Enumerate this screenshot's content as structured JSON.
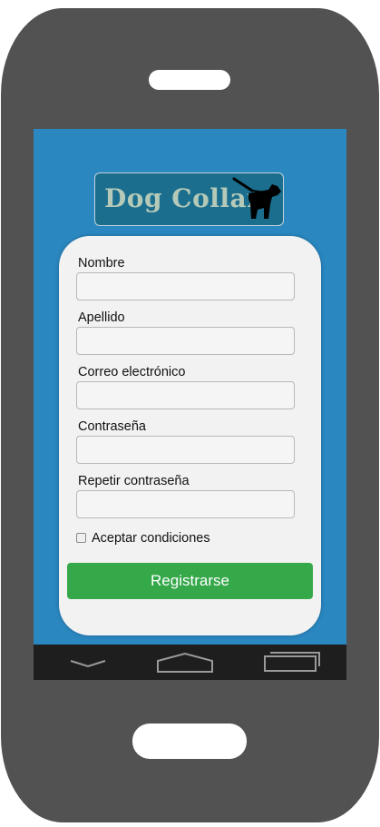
{
  "app": {
    "logo_text": "Dog Collar",
    "logo_icon": "dog-walker-icon"
  },
  "form": {
    "fields": [
      {
        "label": "Nombre",
        "value": "",
        "placeholder": ""
      },
      {
        "label": "Apellido",
        "value": "",
        "placeholder": ""
      },
      {
        "label": "Correo electrónico",
        "value": "",
        "placeholder": ""
      },
      {
        "label": "Contraseña",
        "value": "",
        "placeholder": ""
      },
      {
        "label": "Repetir contraseña",
        "value": "",
        "placeholder": ""
      }
    ],
    "terms_label": "Aceptar condiciones",
    "terms_checked": false,
    "submit_label": "Registrarse"
  },
  "navigation": {
    "back_icon": "chevron-down-icon",
    "home_icon": "home-icon",
    "recents_icon": "recent-apps-icon"
  },
  "colors": {
    "screen_bg": "#2a87c0",
    "logo_bg": "#1b6e8d",
    "button_bg": "#35a84a",
    "phone_body": "#525252",
    "card_bg": "#f2f2f2"
  }
}
